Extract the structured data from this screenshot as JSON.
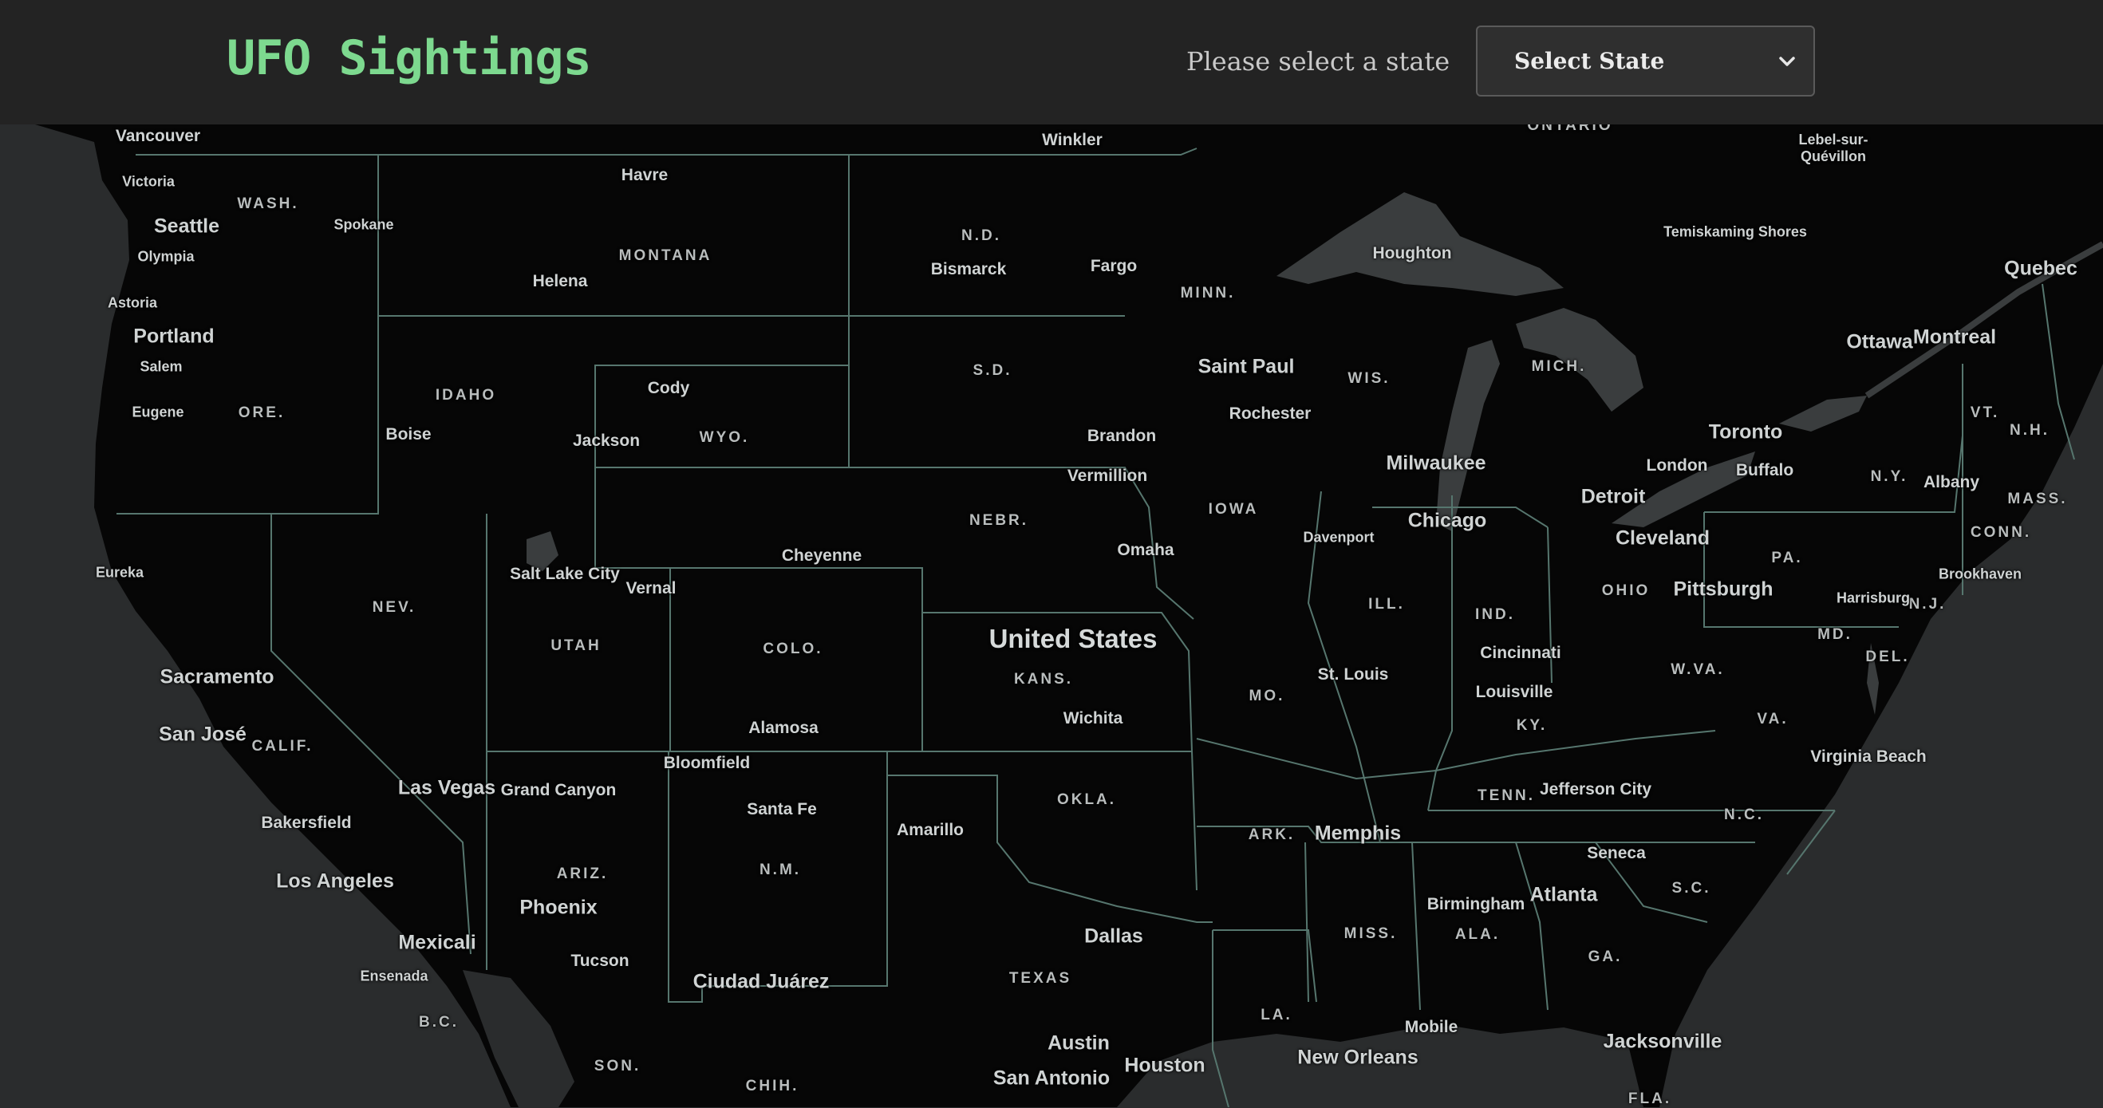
{
  "header": {
    "title": "UFO Sightings",
    "state_prompt": "Please select a state",
    "state_select_value": "Select State"
  },
  "map": {
    "country": "United States",
    "state_labels": [
      "WASH.",
      "MONTANA",
      "N.D.",
      "MINN.",
      "ORE.",
      "IDAHO",
      "WYO.",
      "S.D.",
      "WIS.",
      "MICH.",
      "NEBR.",
      "IOWA",
      "NEV.",
      "UTAH",
      "COLO.",
      "KANS.",
      "ILL.",
      "IND.",
      "OHIO",
      "PA.",
      "N.Y.",
      "VT.",
      "N.H.",
      "MASS.",
      "CONN.",
      "N.J.",
      "MD.",
      "DEL.",
      "W.VA.",
      "VA.",
      "KY.",
      "MO.",
      "CALIF.",
      "OKLA.",
      "ARK.",
      "TENN.",
      "N.C.",
      "S.C.",
      "ARIZ.",
      "N.M.",
      "TEXAS",
      "MISS.",
      "ALA.",
      "GA.",
      "LA.",
      "FLA.",
      "B.C.",
      "SON.",
      "CHIH.",
      "ONTARIO"
    ],
    "city_labels": [
      "Vancouver",
      "Victoria",
      "Seattle",
      "Olympia",
      "Astoria",
      "Portland",
      "Salem",
      "Eugene",
      "Spokane",
      "Havre",
      "Helena",
      "Winkler",
      "Bismarck",
      "Fargo",
      "Houghton",
      "Lebel-sur-Quévillon",
      "Temiskaming Shores",
      "Quebec",
      "Ottawa",
      "Montreal",
      "Cody",
      "Jackson",
      "Boise",
      "Saint Paul",
      "Rochester",
      "Brandon",
      "Vermillion",
      "Milwaukee",
      "Toronto",
      "London",
      "Buffalo",
      "Albany",
      "Detroit",
      "Chicago",
      "Omaha",
      "Davenport",
      "Cleveland",
      "Pittsburgh",
      "Harrisburg",
      "Brookhaven",
      "Eureka",
      "Salt Lake City",
      "Vernal",
      "Cheyenne",
      "Cincinnati",
      "Louisville",
      "St. Louis",
      "Sacramento",
      "San José",
      "Alamosa",
      "Wichita",
      "Virginia Beach",
      "Las Vegas",
      "Grand Canyon",
      "Bloomfield",
      "Santa Fe",
      "Amarillo",
      "Jefferson City",
      "Memphis",
      "Bakersfield",
      "Los Angeles",
      "Phoenix",
      "Seneca",
      "Atlanta",
      "Birmingham",
      "Mexicali",
      "Ensenada",
      "Tucson",
      "Ciudad Juárez",
      "Dallas",
      "Austin",
      "San Antonio",
      "Houston",
      "New Orleans",
      "Mobile",
      "Jacksonville"
    ]
  },
  "colors": {
    "title": "#7dd98f",
    "header_bg": "#232323",
    "land": "#060606",
    "water": "#3a3d3e",
    "borders": "#56766e"
  },
  "icons": [
    "chevron-down-icon"
  ]
}
